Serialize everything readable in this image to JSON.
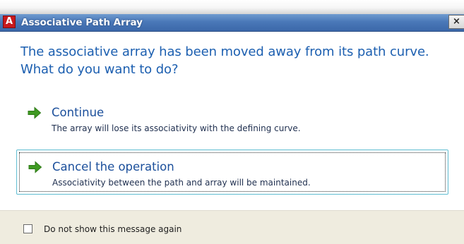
{
  "window": {
    "app_icon_letter": "A",
    "title": "Associative Path Array",
    "close_glyph": "×"
  },
  "main_instruction": "The associative array has been moved away from its path curve. What do you want to do?",
  "commands": [
    {
      "title": "Continue",
      "description": "The array will lose its associativity with the defining curve.",
      "icon": "green-arrow-icon"
    },
    {
      "title": "Cancel the operation",
      "description": "Associativity between the path and array will be maintained.",
      "icon": "green-arrow-icon",
      "selected": true
    }
  ],
  "footer": {
    "checkbox_label": "Do not show this message again",
    "checked": false
  },
  "colors": {
    "titlebar": "#4a78b8",
    "instruction_text": "#1c5fb0",
    "command_title": "#1b4f9b",
    "arrow": "#3f9a22",
    "footer_bg": "#efecdf",
    "selection_border": "#66bfd3"
  }
}
